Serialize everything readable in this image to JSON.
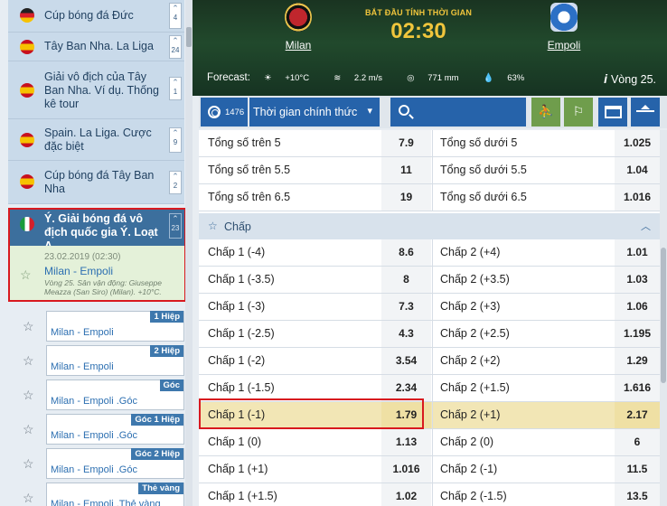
{
  "sidebar": {
    "leagues": [
      {
        "name": "Cúp bóng đá Đức",
        "count": "4",
        "flag": "de"
      },
      {
        "name": "Tây Ban Nha. La Liga",
        "count": "24",
        "flag": "es"
      },
      {
        "name": "Giải vô địch của Tây Ban Nha. Ví dụ. Thống kê tour",
        "count": "1",
        "flag": "es"
      },
      {
        "name": "Spain. La Liga. Cược đặc biệt",
        "count": "9",
        "flag": "es"
      },
      {
        "name": "Cúp bóng đá Tây Ban Nha",
        "count": "2",
        "flag": "es"
      },
      {
        "name": "Ý. Giải bóng đá vô địch quốc gia Ý. Loạt A.",
        "count": "23",
        "flag": "it"
      }
    ],
    "current_match": {
      "date": "23.02.2019 (02:30)",
      "teams": "Milan - Empoli",
      "info": "Vòng 25. Sân vận động: Giuseppe Meazza (San Siro) (Milan). +10°C."
    },
    "markets": [
      {
        "tag": "1 Hiệp",
        "title": "Milan - Empoli"
      },
      {
        "tag": "2 Hiệp",
        "title": "Milan - Empoli"
      },
      {
        "tag": "Góc",
        "title": "Milan - Empoli .Góc"
      },
      {
        "tag": "Góc 1 Hiệp",
        "title": "Milan - Empoli .Góc"
      },
      {
        "tag": "Góc 2 Hiệp",
        "title": "Milan - Empoli .Góc"
      },
      {
        "tag": "Thẻ vàng",
        "title": "Milan - Empoli .Thẻ vàng"
      }
    ]
  },
  "header": {
    "home": "Milan",
    "away": "Empoli",
    "kickoff_label": "BẮT ĐẦU TÍNH THỜI GIAN",
    "kickoff_time": "02:30",
    "forecast_label": "Forecast:",
    "temp": "+10°C",
    "wind": "2.2 m/s",
    "pressure": "771 mm",
    "humidity": "63%",
    "round": "Vòng 25."
  },
  "filter": {
    "count": "1476",
    "select": "Thời gian chính thức"
  },
  "odds": {
    "top_rows": [
      {
        "l1": "Tổng số trên 5",
        "v1": "7.9",
        "l2": "Tổng số dưới 5",
        "v2": "1.025"
      },
      {
        "l1": "Tổng số trên 5.5",
        "v1": "11",
        "l2": "Tổng số dưới 5.5",
        "v2": "1.04"
      },
      {
        "l1": "Tổng số trên 6.5",
        "v1": "19",
        "l2": "Tổng số dưới 6.5",
        "v2": "1.016"
      }
    ],
    "section_title": "Chấp",
    "handicap_rows": [
      {
        "l1": "Chấp 1 (-4)",
        "v1": "8.6",
        "l2": "Chấp 2 (+4)",
        "v2": "1.01"
      },
      {
        "l1": "Chấp 1 (-3.5)",
        "v1": "8",
        "l2": "Chấp 2 (+3.5)",
        "v2": "1.03"
      },
      {
        "l1": "Chấp 1 (-3)",
        "v1": "7.3",
        "l2": "Chấp 2 (+3)",
        "v2": "1.06"
      },
      {
        "l1": "Chấp 1 (-2.5)",
        "v1": "4.3",
        "l2": "Chấp 2 (+2.5)",
        "v2": "1.195"
      },
      {
        "l1": "Chấp 1 (-2)",
        "v1": "3.54",
        "l2": "Chấp 2 (+2)",
        "v2": "1.29"
      },
      {
        "l1": "Chấp 1 (-1.5)",
        "v1": "2.34",
        "l2": "Chấp 2 (+1.5)",
        "v2": "1.616"
      },
      {
        "l1": "Chấp 1 (-1)",
        "v1": "1.79",
        "l2": "Chấp 2 (+1)",
        "v2": "2.17"
      },
      {
        "l1": "Chấp 1 (0)",
        "v1": "1.13",
        "l2": "Chấp 2 (0)",
        "v2": "6"
      },
      {
        "l1": "Chấp 1 (+1)",
        "v1": "1.016",
        "l2": "Chấp 2 (-1)",
        "v2": "11.5"
      },
      {
        "l1": "Chấp 1 (+1.5)",
        "v1": "1.02",
        "l2": "Chấp 2 (-1.5)",
        "v2": "13.5"
      }
    ]
  },
  "colors": {
    "accent": "#2663aa",
    "highlight": "#d8191f",
    "selected_row": "#f2e6b5"
  }
}
